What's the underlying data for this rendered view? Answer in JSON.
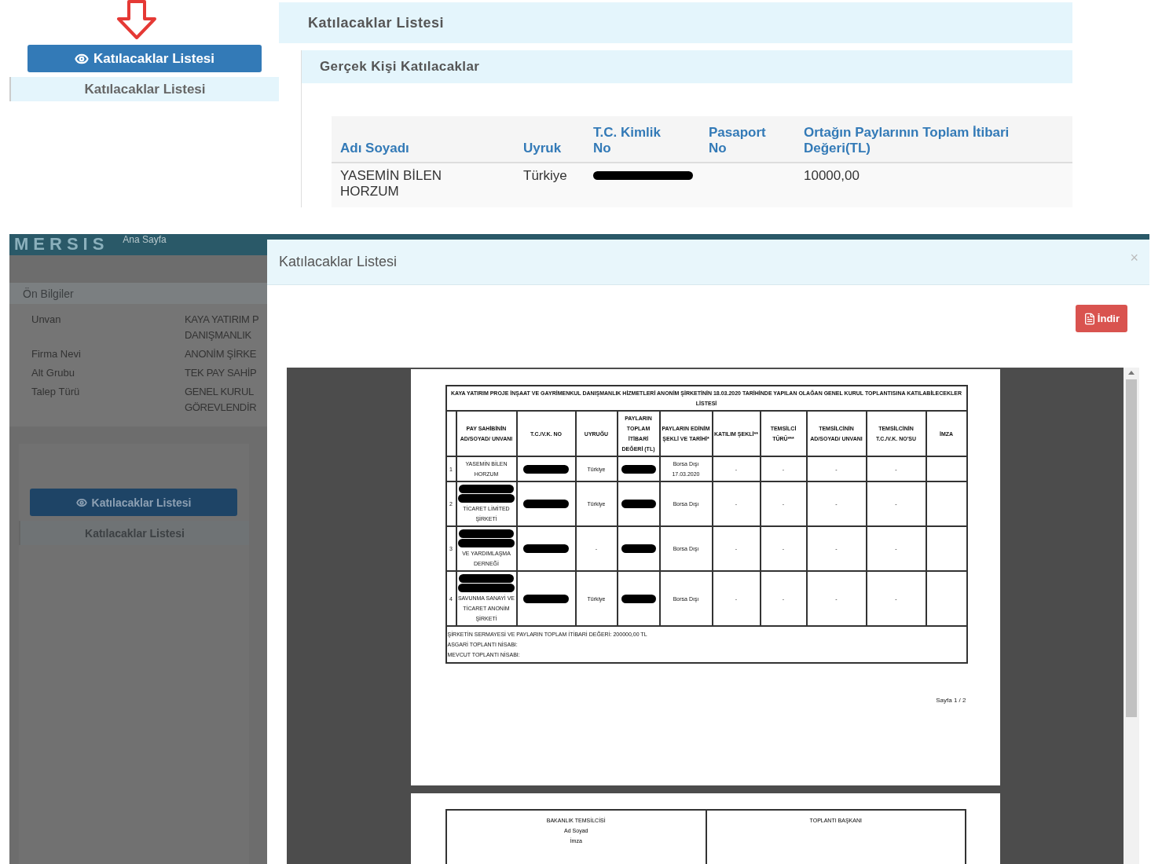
{
  "top": {
    "sidebar": {
      "button": "Katılacaklar Listesi",
      "item": "Katılacaklar Listesi"
    },
    "panel": {
      "title": "Katılacaklar Listesi",
      "section": "Gerçek Kişi Katılacaklar",
      "columns": [
        {
          "lines": [
            "Adı Soyadı"
          ]
        },
        {
          "lines": [
            "Uyruk"
          ]
        },
        {
          "lines": [
            "T.C. Kimlik",
            "No"
          ]
        },
        {
          "lines": [
            "Pasaport",
            "No"
          ]
        },
        {
          "lines": [
            "Ortağın Paylarının Toplam İtibari",
            "Değeri(TL)"
          ]
        }
      ],
      "rows": [
        {
          "name": "YASEMİN BİLEN HORZUM",
          "nationality": "Türkiye",
          "id_redacted": true,
          "value": "10000,00"
        }
      ]
    }
  },
  "app": {
    "logo": "MERSIS",
    "nav": [
      "Ana Sayfa"
    ],
    "info": {
      "title": "Ön Bilgiler",
      "rows": [
        {
          "label": "Unvan",
          "value": [
            "KAYA YATIRIM P",
            "DANIŞMANLIK"
          ]
        },
        {
          "label": "Firma Nevi",
          "value": [
            "ANONİM ŞİRKE"
          ]
        },
        {
          "label": "Alt Grubu",
          "value": [
            "TEK PAY SAHİP"
          ]
        },
        {
          "label": "Talep Türü",
          "value": [
            "GENEL KURUL",
            "GÖREVLENDİR"
          ]
        }
      ]
    },
    "button": "Katılacaklar Listesi",
    "item": "Katılacaklar Listesi"
  },
  "modal": {
    "title": "Katılacaklar Listesi",
    "close": "×",
    "download": "İndir",
    "document": {
      "title": "KAYA YATIRIM PROJE İNŞAAT VE GAYRİMENKUL DANIŞMANLIK HİZMETLERİ ANONİM ŞİRKETİNİN 18.03.2020 TARİHİNDE YAPILAN OLAĞAN GENEL KURUL TOPLANTISINA KATILABİLECEKLER LİSTESİ",
      "columns": [
        "PAY SAHİBİNİN AD/SOYAD/ UNVANI",
        "T.C./V.K. NO",
        "UYRUĞU",
        "PAYLARIN TOPLAM İTİBARİ DEĞERİ (TL)",
        "PAYLARIN EDİNİM ŞEKLİ VE TARİHİ*",
        "KATILIM ŞEKLİ**",
        "TEMSİLCİ TÜRÜ***",
        "TEMSİLCİNİN AD/SOYAD/ UNVANI",
        "TEMSİLCİNİN T.C./V.K. NO'SU",
        "İMZA"
      ],
      "rows": [
        {
          "number": "1",
          "holder_redacted": false,
          "holder": "YASEMİN BİLEN HORZUM",
          "id_redacted": true,
          "nationality": "Türkiye",
          "value_redacted": true,
          "acquisition": "Borsa Dışı 17.03.2020",
          "participation": "-",
          "representative_type": "-",
          "representative_name": "-",
          "representative_id": "-"
        },
        {
          "number": "2",
          "holder_redacted": true,
          "holder": "TİCARET LİMİTED ŞİRKETİ",
          "id_redacted": true,
          "nationality": "Türkiye",
          "value_redacted": true,
          "acquisition": "Borsa Dışı",
          "participation": "-",
          "representative_type": "-",
          "representative_name": "-",
          "representative_id": "-"
        },
        {
          "number": "3",
          "holder_redacted": true,
          "holder": "VE YARDIMLAŞMA DERNEĞİ",
          "id_redacted": true,
          "nationality": "-",
          "value_redacted": true,
          "acquisition": "Borsa Dışı",
          "participation": "-",
          "representative_type": "-",
          "representative_name": "-",
          "representative_id": "-"
        },
        {
          "number": "4",
          "holder_redacted": true,
          "holder": "SAVUNMA SANAYİ VE TİCARET ANONİM ŞİRKETİ",
          "id_redacted": true,
          "nationality": "Türkiye",
          "value_redacted": true,
          "acquisition": "Borsa Dışı",
          "participation": "-",
          "representative_type": "-",
          "representative_name": "-",
          "representative_id": "-"
        }
      ],
      "footer": [
        "ŞİRKETİN SERMAYESİ VE PAYLARIN TOPLAM İTİBARİ DEĞERİ: 200000,00 TL",
        "ASGARİ TOPLANTI NİSABI:",
        "MEVCUT TOPLANTI NİSABI:"
      ],
      "page_label": "Sayfa 1 / 2",
      "signatures": [
        {
          "lines": [
            "BAKANLIK TEMSİLCİSİ",
            "Ad Soyad",
            "İmza"
          ]
        },
        {
          "lines": [
            "TOPLANTI BAŞKANI"
          ]
        }
      ]
    }
  }
}
